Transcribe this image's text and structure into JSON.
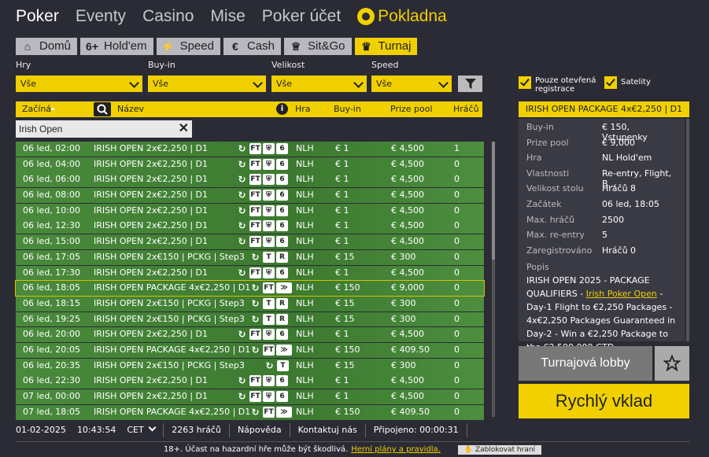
{
  "nav": {
    "items": [
      "Poker",
      "Eventy",
      "Casino",
      "Mise",
      "Poker účet"
    ],
    "cashier": "Pokladna"
  },
  "tabs": [
    {
      "icon": "⌂",
      "label": "Domů"
    },
    {
      "icon": "6+",
      "label": "Hold'em"
    },
    {
      "icon": "⚡",
      "label": "Speed"
    },
    {
      "icon": "€",
      "label": "Cash"
    },
    {
      "icon": "♕",
      "label": "Sit&Go"
    },
    {
      "icon": "♛",
      "label": "Turnaj"
    }
  ],
  "filters": {
    "hry": {
      "label": "Hry",
      "value": "Vše"
    },
    "buyin": {
      "label": "Buy-in",
      "value": "Vše"
    },
    "velikost": {
      "label": "Velikost",
      "value": "Vše"
    },
    "speed": {
      "label": "Speed",
      "value": "Vše"
    }
  },
  "checks": {
    "open": "Pouze otevřená registrace",
    "sat": "Satelity"
  },
  "table": {
    "headers": {
      "start": "Začíná",
      "name": "Název",
      "game": "Hra",
      "buyin": "Buy-in",
      "prize": "Prize pool",
      "players": "Hráčů"
    },
    "search": "Irish Open",
    "rows": [
      {
        "date": "06 led, 02:00",
        "name": "IRISH OPEN 2x€2,250 | D1",
        "icons": [
          "↻",
          "FT",
          "⛨",
          "6"
        ],
        "game": "NLH",
        "buyin": "€ 1",
        "prize": "€ 4,500",
        "players": "1"
      },
      {
        "date": "06 led, 04:00",
        "name": "IRISH OPEN 2x€2,250 | D1",
        "icons": [
          "↻",
          "FT",
          "⛨",
          "6"
        ],
        "game": "NLH",
        "buyin": "€ 1",
        "prize": "€ 4,500",
        "players": "0"
      },
      {
        "date": "06 led, 06:00",
        "name": "IRISH OPEN 2x€2,250 | D1",
        "icons": [
          "↻",
          "FT",
          "⛨",
          "6"
        ],
        "game": "NLH",
        "buyin": "€ 1",
        "prize": "€ 4,500",
        "players": "0"
      },
      {
        "date": "06 led, 08:00",
        "name": "IRISH OPEN 2x€2,250 | D1",
        "icons": [
          "↻",
          "FT",
          "⛨",
          "6"
        ],
        "game": "NLH",
        "buyin": "€ 1",
        "prize": "€ 4,500",
        "players": "0"
      },
      {
        "date": "06 led, 10:00",
        "name": "IRISH OPEN 2x€2,250 | D1",
        "icons": [
          "↻",
          "FT",
          "⛨",
          "6"
        ],
        "game": "NLH",
        "buyin": "€ 1",
        "prize": "€ 4,500",
        "players": "0"
      },
      {
        "date": "06 led, 12:30",
        "name": "IRISH OPEN 2x€2,250 | D1",
        "icons": [
          "↻",
          "FT",
          "⛨",
          "6"
        ],
        "game": "NLH",
        "buyin": "€ 1",
        "prize": "€ 4,500",
        "players": "0"
      },
      {
        "date": "06 led, 15:00",
        "name": "IRISH OPEN 2x€2,250 | D1",
        "icons": [
          "↻",
          "FT",
          "⛨",
          "6"
        ],
        "game": "NLH",
        "buyin": "€ 1",
        "prize": "€ 4,500",
        "players": "0"
      },
      {
        "date": "06 led, 17:05",
        "name": "IRISH OPEN 2x€150 | PCKG | Step3",
        "icons": [
          "↻",
          "T",
          "R"
        ],
        "game": "NLH",
        "buyin": "€ 15",
        "prize": "€ 300",
        "players": "0"
      },
      {
        "date": "06 led, 17:30",
        "name": "IRISH OPEN 2x€2,250 | D1",
        "icons": [
          "↻",
          "FT",
          "⛨",
          "6"
        ],
        "game": "NLH",
        "buyin": "€ 1",
        "prize": "€ 4,500",
        "players": "0"
      },
      {
        "date": "06 led, 18:05",
        "name": "IRISH OPEN PACKAGE 4x€2,250 | D1",
        "icons": [
          "↻",
          "FT",
          "≫"
        ],
        "game": "NLH",
        "buyin": "€ 150",
        "prize": "€ 9,000",
        "players": "0",
        "hl": true
      },
      {
        "date": "06 led, 18:15",
        "name": "IRISH OPEN 2x€150 | PCKG | Step3",
        "icons": [
          "↻",
          "T",
          "R"
        ],
        "game": "NLH",
        "buyin": "€ 15",
        "prize": "€ 300",
        "players": "0"
      },
      {
        "date": "06 led, 19:25",
        "name": "IRISH OPEN 2x€150 | PCKG | Step3",
        "icons": [
          "↻",
          "T",
          "R"
        ],
        "game": "NLH",
        "buyin": "€ 15",
        "prize": "€ 300",
        "players": "0"
      },
      {
        "date": "06 led, 20:00",
        "name": "IRISH OPEN 2x€2,250 | D1",
        "icons": [
          "↻",
          "FT",
          "⛨",
          "6"
        ],
        "game": "NLH",
        "buyin": "€ 1",
        "prize": "€ 4,500",
        "players": "0"
      },
      {
        "date": "06 led, 20:05",
        "name": "IRISH OPEN PACKAGE 4x€2,250 | D1",
        "icons": [
          "↻",
          "FT",
          "≫"
        ],
        "game": "NLH",
        "buyin": "€ 150",
        "prize": "€ 409.50",
        "players": "0"
      },
      {
        "date": "06 led, 20:35",
        "name": "IRISH OPEN 2x€150 | PCKG | Step3",
        "icons": [
          "↻",
          "T"
        ],
        "game": "NLH",
        "buyin": "€ 15",
        "prize": "€ 300",
        "players": "0"
      },
      {
        "date": "06 led, 22:30",
        "name": "IRISH OPEN 2x€2,250 | D1",
        "icons": [
          "↻",
          "FT",
          "⛨",
          "6"
        ],
        "game": "NLH",
        "buyin": "€ 1",
        "prize": "€ 4,500",
        "players": "0"
      },
      {
        "date": "07 led, 00:00",
        "name": "IRISH OPEN 2x€2,250 | D1",
        "icons": [
          "↻",
          "FT",
          "⛨",
          "6"
        ],
        "game": "NLH",
        "buyin": "€ 1",
        "prize": "€ 4,500",
        "players": "0"
      },
      {
        "date": "07 led, 18:05",
        "name": "IRISH OPEN PACKAGE 4x€2,250 | D1",
        "icons": [
          "↻",
          "FT",
          "≫"
        ],
        "game": "NLH",
        "buyin": "€ 150",
        "prize": "€ 409.50",
        "players": "0"
      }
    ]
  },
  "details": {
    "title": "IRISH OPEN PACKAGE 4x€2,250 | D1",
    "rows": [
      {
        "k": "Buy-in",
        "v": "€ 150, Vstupenky"
      },
      {
        "k": "Prize pool",
        "v": "€ 9,000"
      },
      {
        "k": "Hra",
        "v": "NL Hold'em"
      },
      {
        "k": "Vlastnosti",
        "v": "Re-entry, Flight, B..."
      },
      {
        "k": "Velikost stolu",
        "v": "Hráčů 8"
      },
      {
        "k": "Začátek",
        "v": "06 led, 18:05"
      },
      {
        "k": "Max. hráčů",
        "v": "2500"
      },
      {
        "k": "Max. re-entry",
        "v": "5"
      },
      {
        "k": "Zaregistrováno",
        "v": "Hráčů 0"
      }
    ],
    "desc_label": "Popis",
    "desc_a": "IRISH OPEN 2025 - PACKAGE QUALIFIERS - ",
    "desc_link": "Irish Poker Open",
    "desc_b": " - Day-1 Flight to €2,250 Packages - 4x€2,250 Packages Guaranteed in Day-2 - Win a €2,250 Package to the €2,500,000 GTD"
  },
  "buttons": {
    "lobby": "Turnajová lobby",
    "deposit": "Rychlý vklad"
  },
  "status": {
    "date": "01-02-2025",
    "time": "10:43:54",
    "tz": "CET",
    "players": "2263 hráčů",
    "help": "Nápověda",
    "contact": "Kontaktuj nás",
    "connected": "Připojeno: 00:00:31"
  },
  "footer": {
    "text": "18+. Účast na hazardní hře může být škodlivá.",
    "link": "Herní plány a pravidla.",
    "block": "Zablokovat hraní"
  },
  "colors": {
    "accent": "#f0d000",
    "row_green": "#3c7a30",
    "bg": "#2b2b35"
  }
}
